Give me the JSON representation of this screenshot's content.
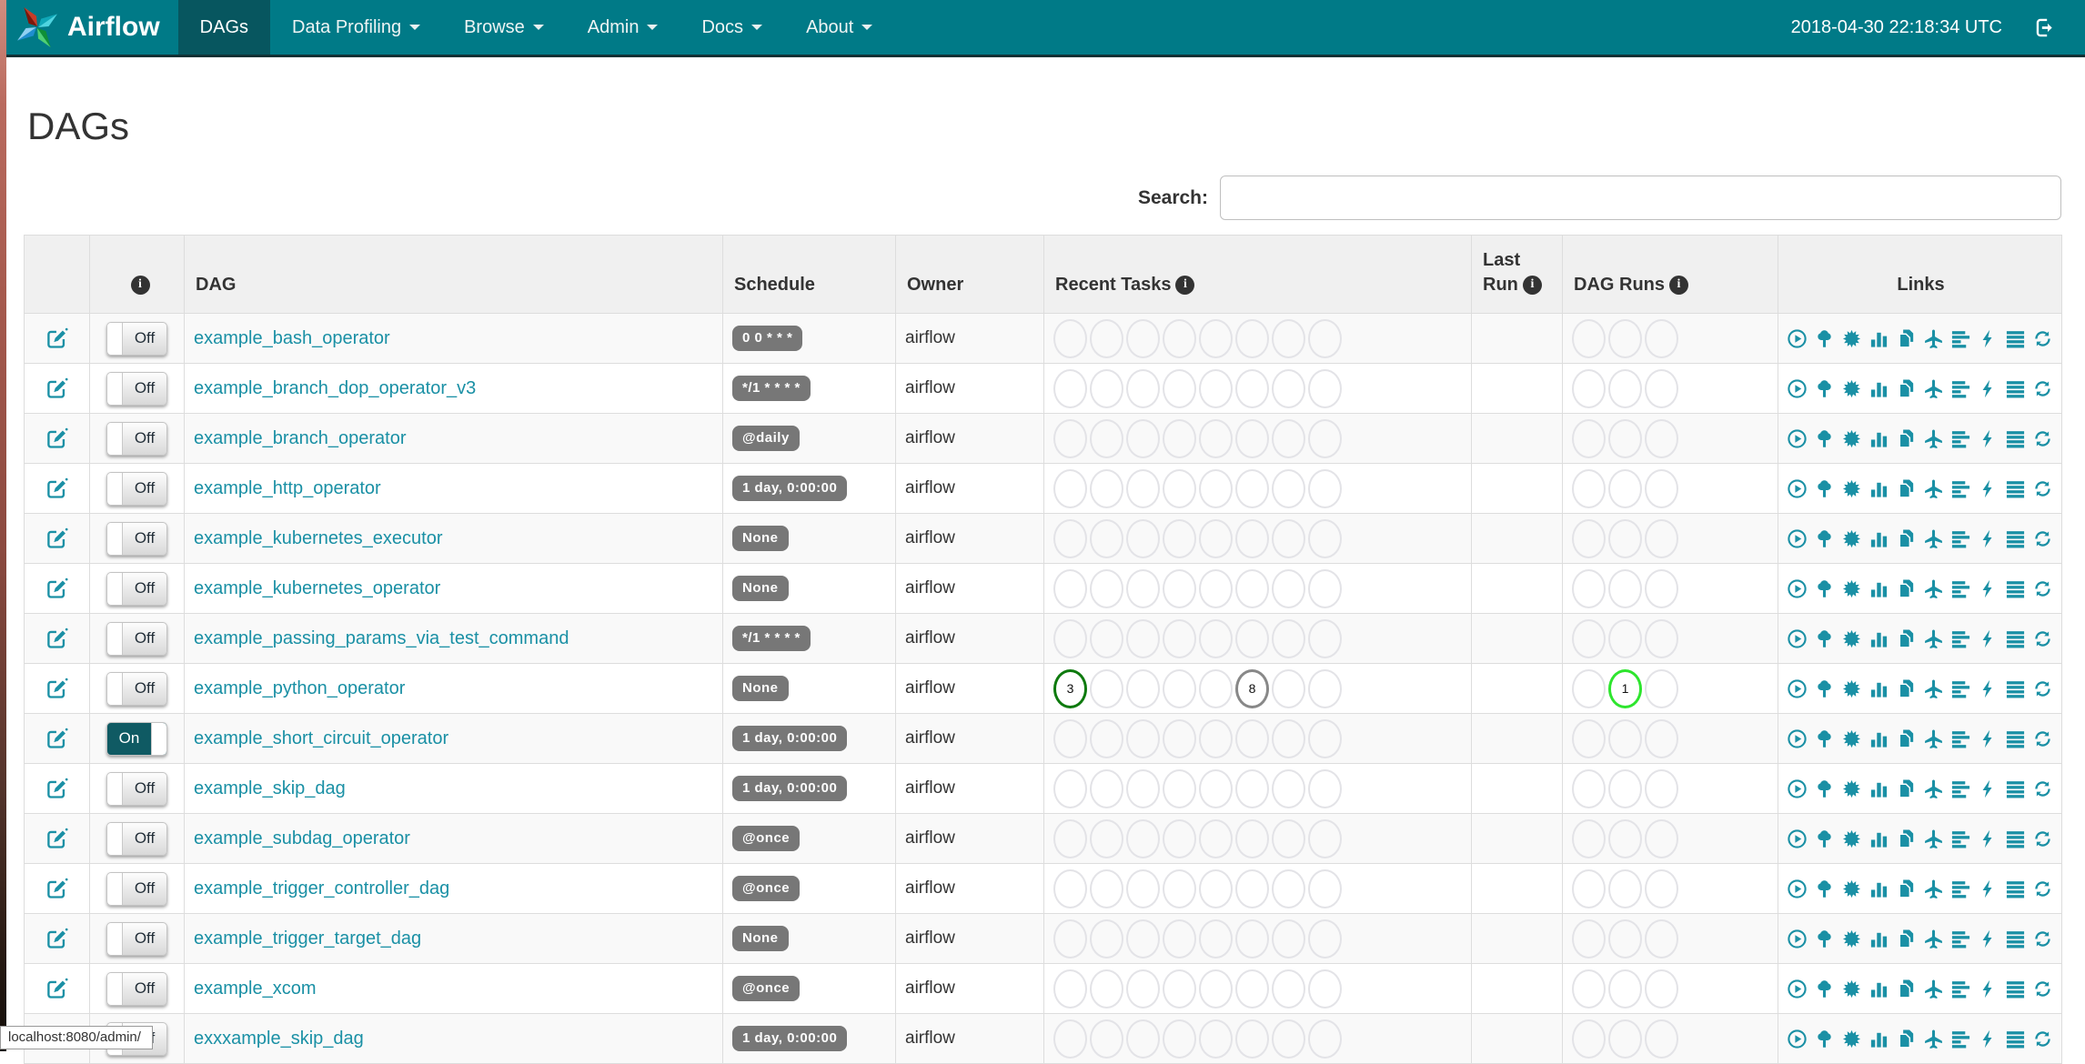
{
  "colors": {
    "navbar_teal": "#007a87",
    "navbar_active_teal": "#07565f",
    "accent_teal": "#1a90a5",
    "badge_gray": "#777777",
    "toggle_on_teal": "#0f5a63",
    "task_success_green": "#0e7a0e",
    "task_none_gray": "#888888",
    "run_running_lime": "#2ee52e"
  },
  "navbar": {
    "brand": "Airflow",
    "items": [
      {
        "label": "DAGs",
        "active": true,
        "caret": false
      },
      {
        "label": "Data Profiling",
        "active": false,
        "caret": true
      },
      {
        "label": "Browse",
        "active": false,
        "caret": true
      },
      {
        "label": "Admin",
        "active": false,
        "caret": true
      },
      {
        "label": "Docs",
        "active": false,
        "caret": true
      },
      {
        "label": "About",
        "active": false,
        "caret": true
      }
    ],
    "clock": "2018-04-30 22:18:34 UTC"
  },
  "page": {
    "title": "DAGs",
    "search_label": "Search:",
    "search_value": "",
    "status_bar": "localhost:8080/admin/"
  },
  "table": {
    "headers": {
      "dag": "DAG",
      "schedule": "Schedule",
      "owner": "Owner",
      "recent_tasks": "Recent Tasks",
      "last_run": "Last Run",
      "dag_runs": "DAG Runs",
      "links": "Links",
      "info_glyph": "i"
    },
    "recent_task_slots": 8,
    "dag_run_slots": 3,
    "links": [
      {
        "name": "trigger-dag-icon"
      },
      {
        "name": "tree-view-icon"
      },
      {
        "name": "graph-view-icon"
      },
      {
        "name": "task-duration-icon"
      },
      {
        "name": "task-tries-icon"
      },
      {
        "name": "landing-times-icon"
      },
      {
        "name": "gantt-icon"
      },
      {
        "name": "code-view-icon"
      },
      {
        "name": "logs-icon"
      },
      {
        "name": "refresh-icon"
      }
    ],
    "toggle_on_label": "On",
    "toggle_off_label": "Off",
    "rows": [
      {
        "dag": "example_bash_operator",
        "schedule": "0 0 * * *",
        "owner": "airflow",
        "toggle": "Off",
        "last_run": "",
        "tasks": [],
        "runs": []
      },
      {
        "dag": "example_branch_dop_operator_v3",
        "schedule": "*/1 * * * *",
        "owner": "airflow",
        "toggle": "Off",
        "last_run": "",
        "tasks": [],
        "runs": []
      },
      {
        "dag": "example_branch_operator",
        "schedule": "@daily",
        "owner": "airflow",
        "toggle": "Off",
        "last_run": "",
        "tasks": [],
        "runs": []
      },
      {
        "dag": "example_http_operator",
        "schedule": "1 day, 0:00:00",
        "owner": "airflow",
        "toggle": "Off",
        "last_run": "",
        "tasks": [],
        "runs": []
      },
      {
        "dag": "example_kubernetes_executor",
        "schedule": "None",
        "owner": "airflow",
        "toggle": "Off",
        "last_run": "",
        "tasks": [],
        "runs": []
      },
      {
        "dag": "example_kubernetes_operator",
        "schedule": "None",
        "owner": "airflow",
        "toggle": "Off",
        "last_run": "",
        "tasks": [],
        "runs": []
      },
      {
        "dag": "example_passing_params_via_test_command",
        "schedule": "*/1 * * * *",
        "owner": "airflow",
        "toggle": "Off",
        "last_run": "",
        "tasks": [],
        "runs": []
      },
      {
        "dag": "example_python_operator",
        "schedule": "None",
        "owner": "airflow",
        "toggle": "Off",
        "last_run": "",
        "tasks": [
          {
            "slot": 1,
            "count": "3",
            "type": "task_success_green"
          },
          {
            "slot": 6,
            "count": "8",
            "type": "task_none_gray"
          }
        ],
        "runs": [
          {
            "slot": 2,
            "count": "1",
            "type": "run_running_lime"
          }
        ]
      },
      {
        "dag": "example_short_circuit_operator",
        "schedule": "1 day, 0:00:00",
        "owner": "airflow",
        "toggle": "On",
        "last_run": "",
        "tasks": [],
        "runs": []
      },
      {
        "dag": "example_skip_dag",
        "schedule": "1 day, 0:00:00",
        "owner": "airflow",
        "toggle": "Off",
        "last_run": "",
        "tasks": [],
        "runs": []
      },
      {
        "dag": "example_subdag_operator",
        "schedule": "@once",
        "owner": "airflow",
        "toggle": "Off",
        "last_run": "",
        "tasks": [],
        "runs": []
      },
      {
        "dag": "example_trigger_controller_dag",
        "schedule": "@once",
        "owner": "airflow",
        "toggle": "Off",
        "last_run": "",
        "tasks": [],
        "runs": []
      },
      {
        "dag": "example_trigger_target_dag",
        "schedule": "None",
        "owner": "airflow",
        "toggle": "Off",
        "last_run": "",
        "tasks": [],
        "runs": []
      },
      {
        "dag": "example_xcom",
        "schedule": "@once",
        "owner": "airflow",
        "toggle": "Off",
        "last_run": "",
        "tasks": [],
        "runs": []
      },
      {
        "dag": "exxxample_skip_dag",
        "schedule": "1 day, 0:00:00",
        "owner": "airflow",
        "toggle": "Off",
        "last_run": "",
        "tasks": [],
        "runs": []
      }
    ]
  }
}
